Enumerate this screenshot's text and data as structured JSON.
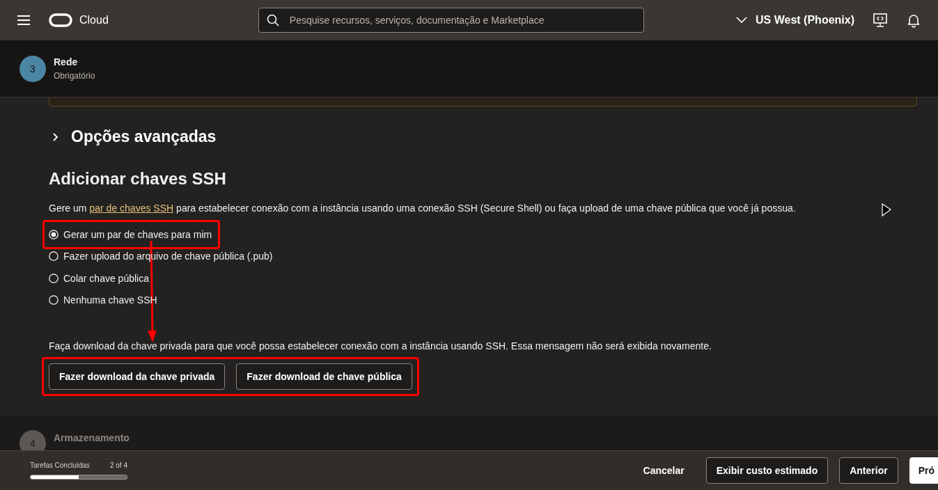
{
  "header": {
    "brand": "Cloud",
    "search": {
      "placeholder": "Pesquise recursos, serviços, documentação e Marketplace"
    },
    "region": "US West (Phoenix)"
  },
  "current_step": {
    "number": "3",
    "title": "Rede",
    "subtitle": "Obrigatório"
  },
  "advanced_options": {
    "label": "Opções avançadas",
    "expanded": false
  },
  "ssh_section": {
    "title": "Adicionar chaves SSH",
    "description_start": "Gere um",
    "link": "par de chaves SSH",
    "description_end": "para estabelecer conexão com a instância usando uma conexão SSH (Secure Shell) ou faça upload de uma chave pública que você já possua.",
    "options": [
      {
        "label": "Gerar um par de chaves para mim",
        "selected": true
      },
      {
        "label": "Fazer upload do arquivo de chave pública (.pub)",
        "selected": false
      },
      {
        "label": "Colar chave pública",
        "selected": false
      },
      {
        "label": "Nenhuma chave SSH",
        "selected": false
      }
    ],
    "download_note": "Faça download da chave privada para que você possa estabelecer conexão com a instância usando SSH. Essa mensagem não será exibida novamente.",
    "buttons": [
      "Fazer download da chave privada",
      "Fazer download de chave pública"
    ]
  },
  "next_step": {
    "number": "4",
    "title": "Armazenamento"
  },
  "footer": {
    "progress_label": "Tarefas Concluídas",
    "progress_count": "2 of 4",
    "level": 0.5,
    "buttons": [
      {
        "label": "Cancelar",
        "kind": "link"
      },
      {
        "label": "Exibir custo estimado",
        "kind": "outline"
      },
      {
        "label": "Anterior",
        "kind": "outline"
      },
      {
        "label": "Pró",
        "kind": "primary"
      }
    ]
  }
}
